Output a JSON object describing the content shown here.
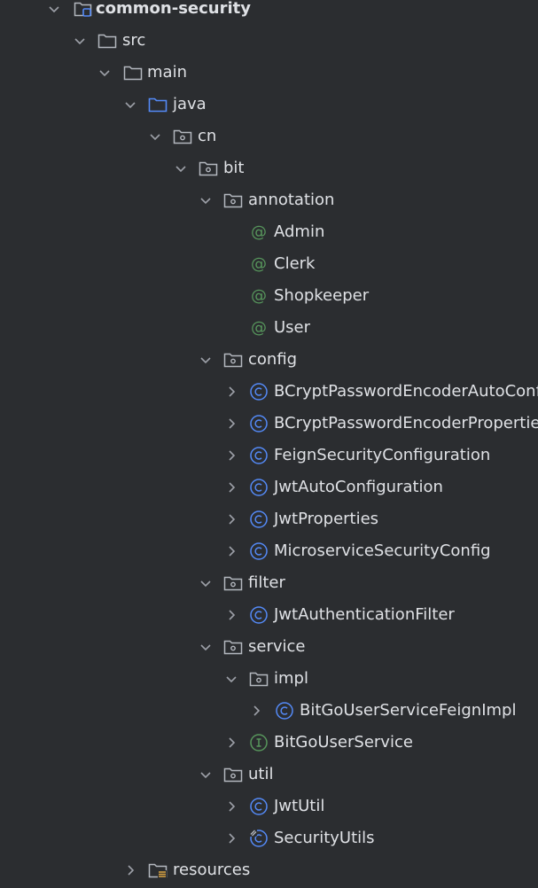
{
  "project_tree": {
    "root": {
      "label": "common-security"
    },
    "src": {
      "label": "src"
    },
    "main": {
      "label": "main"
    },
    "java": {
      "label": "java"
    },
    "cn": {
      "label": "cn"
    },
    "bit": {
      "label": "bit"
    },
    "annotation": {
      "label": "annotation",
      "items": [
        "Admin",
        "Clerk",
        "Shopkeeper",
        "User"
      ]
    },
    "config": {
      "label": "config",
      "items": [
        "BCryptPasswordEncoderAutoConfi",
        "BCryptPasswordEncoderProperties",
        "FeignSecurityConfiguration",
        "JwtAutoConfiguration",
        "JwtProperties",
        "MicroserviceSecurityConfig"
      ]
    },
    "filter": {
      "label": "filter",
      "items": [
        "JwtAuthenticationFilter"
      ]
    },
    "service": {
      "label": "service",
      "impl": {
        "label": "impl",
        "items": [
          "BitGoUserServiceFeignImpl"
        ]
      },
      "items": [
        "BitGoUserService"
      ]
    },
    "util": {
      "label": "util",
      "items": [
        "JwtUtil",
        "SecurityUtils"
      ]
    },
    "resources": {
      "label": "resources"
    }
  },
  "icons": {
    "expanded": "chevron-down-icon",
    "collapsed": "chevron-right-icon",
    "module": "module-folder-icon",
    "folder": "folder-icon",
    "source_root": "source-root-folder-icon",
    "package": "package-icon",
    "annotation": "annotation-icon",
    "class": "class-icon",
    "interface": "interface-icon",
    "resources": "resources-folder-icon"
  },
  "colors": {
    "background": "#2b2d30",
    "text": "#dfe1e5",
    "chevron": "#9da0a8",
    "folder": "#b4b8bf",
    "source_folder": "#548af7",
    "annotation": "#57965c",
    "class": "#548af7",
    "interface": "#57965c"
  }
}
